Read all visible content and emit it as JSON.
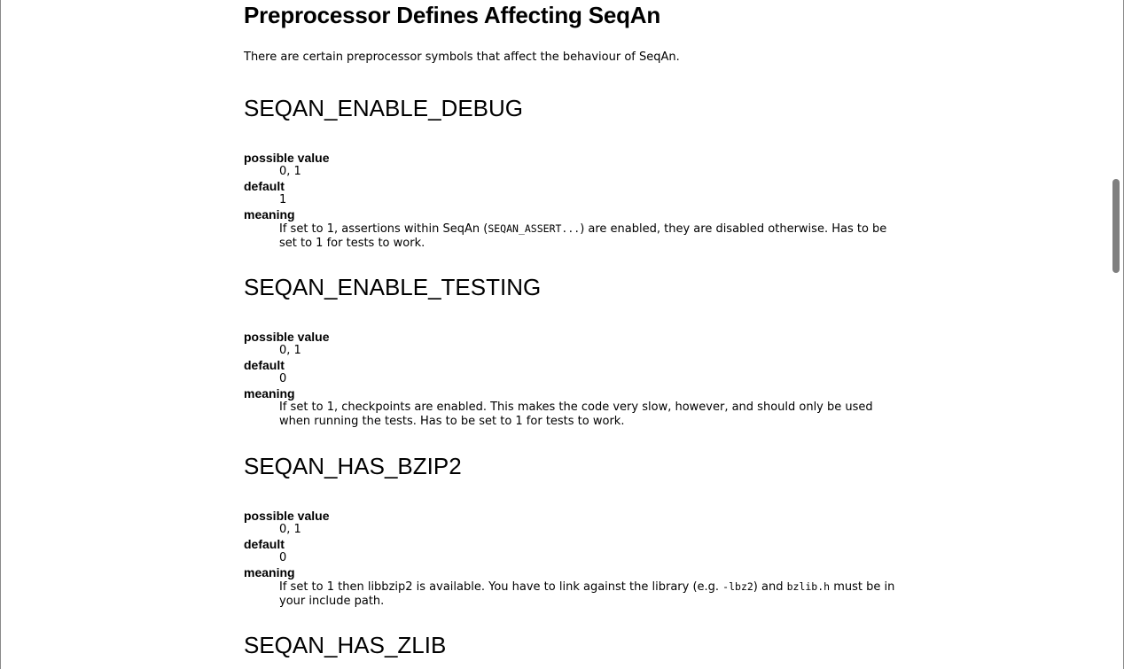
{
  "page": {
    "title": "Preprocessor Defines Affecting SeqAn",
    "intro": "There are certain preprocessor symbols that affect the behaviour of SeqAn."
  },
  "labels": {
    "possible_value": "possible value",
    "default": "default",
    "meaning": "meaning"
  },
  "sections": [
    {
      "name": "SEQAN_ENABLE_DEBUG",
      "possible_value": "0, 1",
      "default": "1",
      "meaning_pre": "If set to 1, assertions within SeqAn (",
      "meaning_code": "SEQAN_ASSERT...",
      "meaning_post": ") are enabled, they are disabled otherwise. Has to be set to 1 for tests to work."
    },
    {
      "name": "SEQAN_ENABLE_TESTING",
      "possible_value": "0, 1",
      "default": "0",
      "meaning": "If set to 1, checkpoints are enabled. This makes the code very slow, however, and should only be used when running the tests. Has to be set to 1 for tests to work."
    },
    {
      "name": "SEQAN_HAS_BZIP2",
      "possible_value": "0, 1",
      "default": "0",
      "meaning_pre": "If set to 1 then libbzip2 is available. You have to link against the library (e.g. ",
      "meaning_code1": "-lbz2",
      "meaning_mid": ") and ",
      "meaning_code2": "bzlib.h",
      "meaning_post": " must be in your include path."
    },
    {
      "name": "SEQAN_HAS_ZLIB"
    }
  ]
}
